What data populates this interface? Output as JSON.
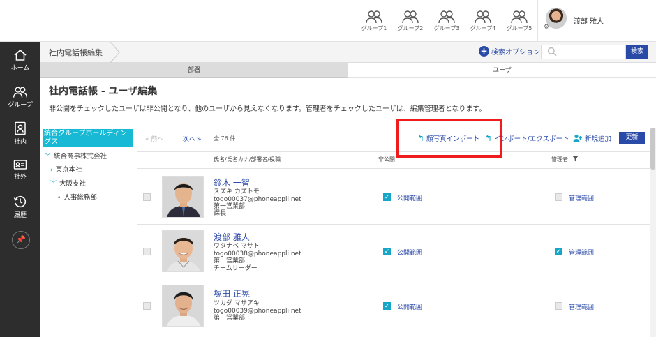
{
  "header": {
    "groups": [
      {
        "label": "グループ1"
      },
      {
        "label": "グループ2"
      },
      {
        "label": "グループ3"
      },
      {
        "label": "グループ4"
      },
      {
        "label": "グループ5"
      }
    ],
    "user_name": "渡部 雅人"
  },
  "sidebar": {
    "items": [
      {
        "label": "ホーム",
        "icon": "home-icon"
      },
      {
        "label": "グループ",
        "icon": "group-icon"
      },
      {
        "label": "社内",
        "icon": "contact-book-icon"
      },
      {
        "label": "社外",
        "icon": "id-card-icon"
      },
      {
        "label": "履歴",
        "icon": "history-icon"
      }
    ]
  },
  "breadcrumb": {
    "label": "社内電話帳編集"
  },
  "search": {
    "option_label": "検索オプション",
    "button_label": "検索",
    "placeholder": ""
  },
  "tabs": [
    {
      "label": "部署"
    },
    {
      "label": "ユーザ"
    }
  ],
  "page": {
    "title": "社内電話帳 - ユーザ編集",
    "description": "非公開をチェックしたユーザは非公開となり、他のユーザから見えなくなります。管理者をチェックしたユーザは、編集管理者となります。"
  },
  "tree": {
    "root": "統合グループホールディングス",
    "items": [
      {
        "label": "統合商事株式会社",
        "marker": "﹀"
      },
      {
        "label": "東京本社",
        "marker": "›"
      },
      {
        "label": "大阪支社",
        "marker": "﹀"
      },
      {
        "label": "人事総務部",
        "marker": "•"
      }
    ]
  },
  "toolbar": {
    "prev": "前へ",
    "next": "次へ",
    "total": "全 76 件",
    "face_import": "顔写真インポート",
    "import_export": "インポート/エクスポート",
    "add_new": "新規追加",
    "refresh": "更新"
  },
  "table": {
    "col_name": "氏名/氏名カナ/部署名/役職",
    "col_private": "非公開",
    "col_admin": "管理者",
    "rows": [
      {
        "name": "鈴木 一智",
        "kana": "スズキ カズトモ",
        "email": "togo00037@phoneappli.net",
        "dept": "第一営業部",
        "role": "課長",
        "private_checked": true,
        "private_label": "公開範囲",
        "admin_checked": false,
        "admin_label": "管理範囲"
      },
      {
        "name": "渡部 雅人",
        "kana": "ワタナベ マサト",
        "email": "togo00038@phoneappli.net",
        "dept": "第一営業部",
        "role": "チームリーダー",
        "private_checked": true,
        "private_label": "公開範囲",
        "admin_checked": true,
        "admin_label": "管理範囲"
      },
      {
        "name": "塚田 正晃",
        "kana": "ツカダ マサアキ",
        "email": "togo00039@phoneappli.net",
        "dept": "第一営業部",
        "role": "",
        "private_checked": true,
        "private_label": "公開範囲",
        "admin_checked": false,
        "admin_label": "管理範囲"
      }
    ]
  },
  "colors": {
    "accent": "#2a4aa8",
    "teal": "#18b9d5",
    "highlight": "#ee1c1c",
    "sidebar": "#2d2d2d"
  }
}
